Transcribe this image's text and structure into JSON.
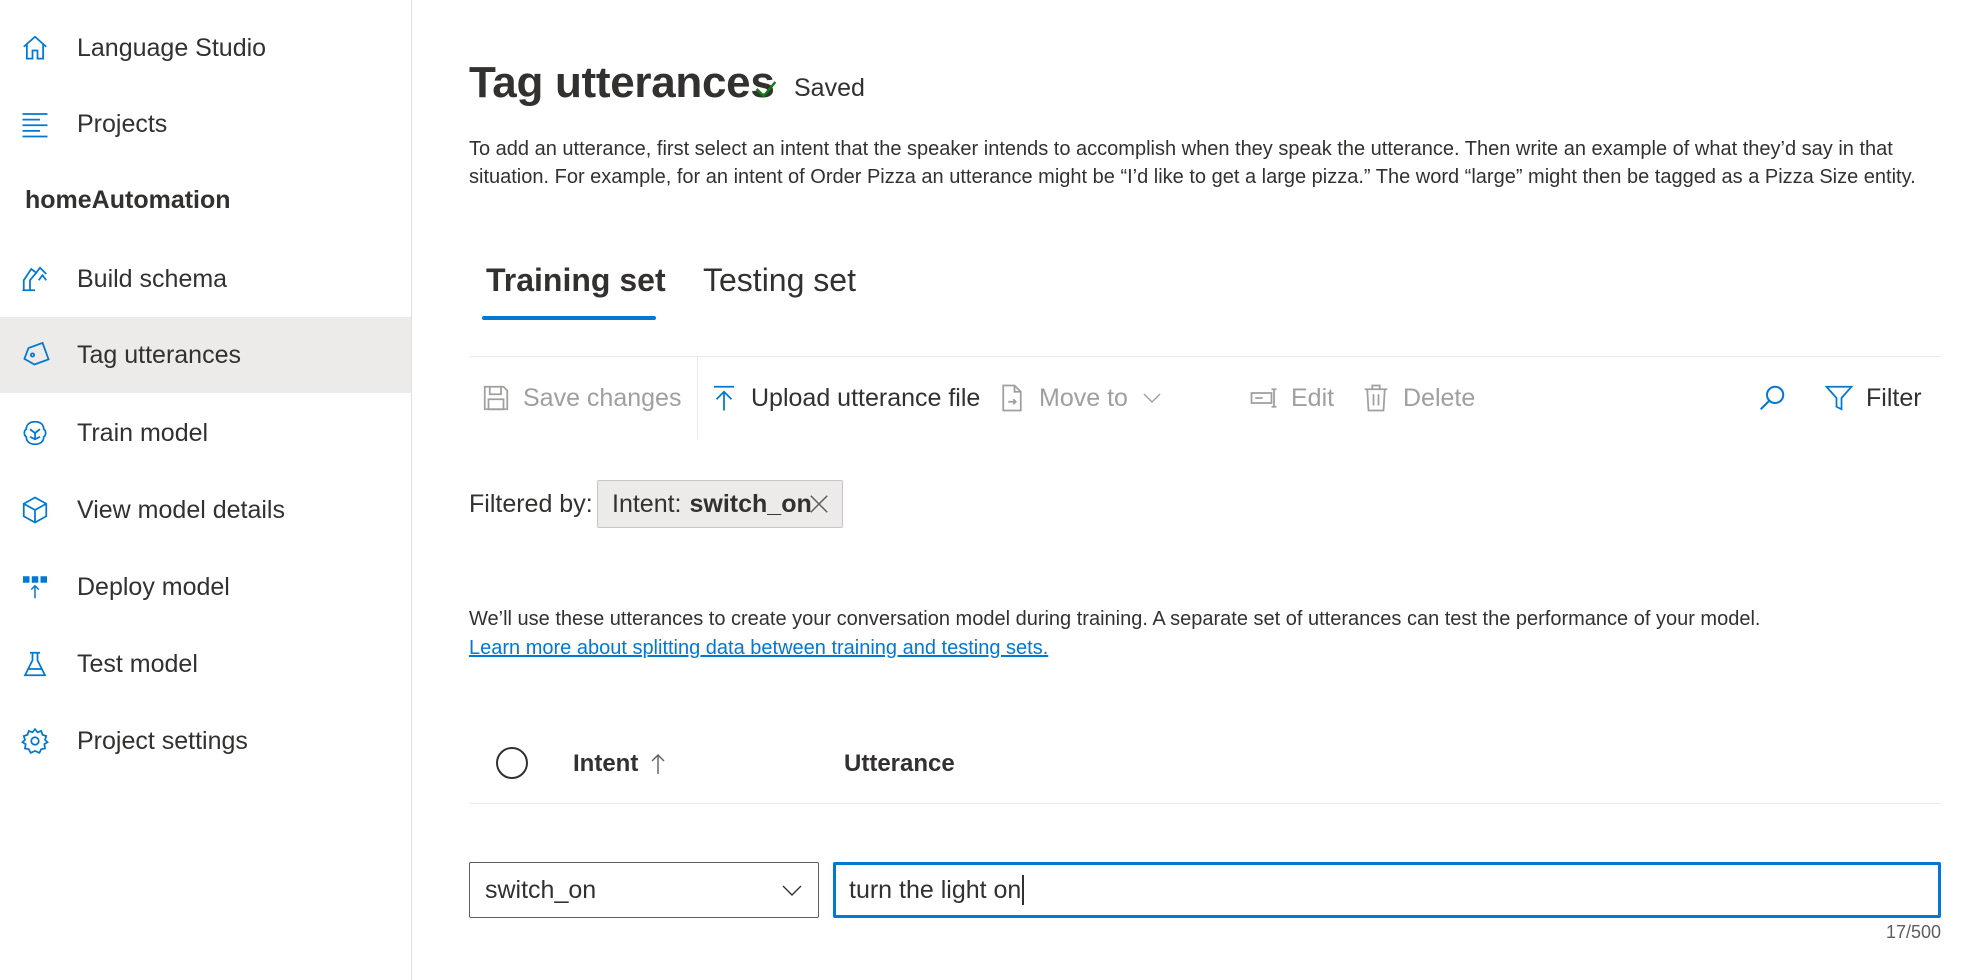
{
  "sidebar": {
    "studio": "Language Studio",
    "projects": "Projects",
    "project_name": "homeAutomation",
    "items": [
      {
        "label": "Build schema"
      },
      {
        "label": "Tag utterances"
      },
      {
        "label": "Train model"
      },
      {
        "label": "View model details"
      },
      {
        "label": "Deploy model"
      },
      {
        "label": "Test model"
      },
      {
        "label": "Project settings"
      }
    ],
    "selected_item": "Tag utterances"
  },
  "main": {
    "title": "Tag utterances",
    "saved": "Saved",
    "description": "To add an utterance, first select an intent that the speaker intends to accomplish when they speak the utterance. Then write an example of what they’d say in that situation. For example, for an intent of Order Pizza an utterance might be “I’d like to get a large pizza.” The word “large” might then be tagged as a Pizza Size entity.",
    "tabs": [
      {
        "label": "Training set",
        "active": true
      },
      {
        "label": "Testing set",
        "active": false
      }
    ],
    "toolbar": {
      "save_changes": "Save changes",
      "upload": "Upload utterance file",
      "move_to": "Move to",
      "edit": "Edit",
      "delete": "Delete",
      "filter": "Filter"
    },
    "filter": {
      "label": "Filtered by:",
      "pill_prefix": "Intent:",
      "pill_value": "switch_on"
    },
    "info_text": "We’ll use these utterances to create your conversation model during training. A separate set of utterances can test the performance of your model.",
    "info_link": "Learn more about splitting data between training and testing sets.",
    "table": {
      "columns": [
        "Intent",
        "Utterance"
      ],
      "sort_direction": "ascending"
    },
    "new_row": {
      "intent_value": "switch_on",
      "utterance_value": "turn the light on",
      "char_count": "17/500"
    }
  },
  "colors": {
    "accent": "#0078d4",
    "selected_bg": "#edebe9",
    "success": "#107c10"
  }
}
